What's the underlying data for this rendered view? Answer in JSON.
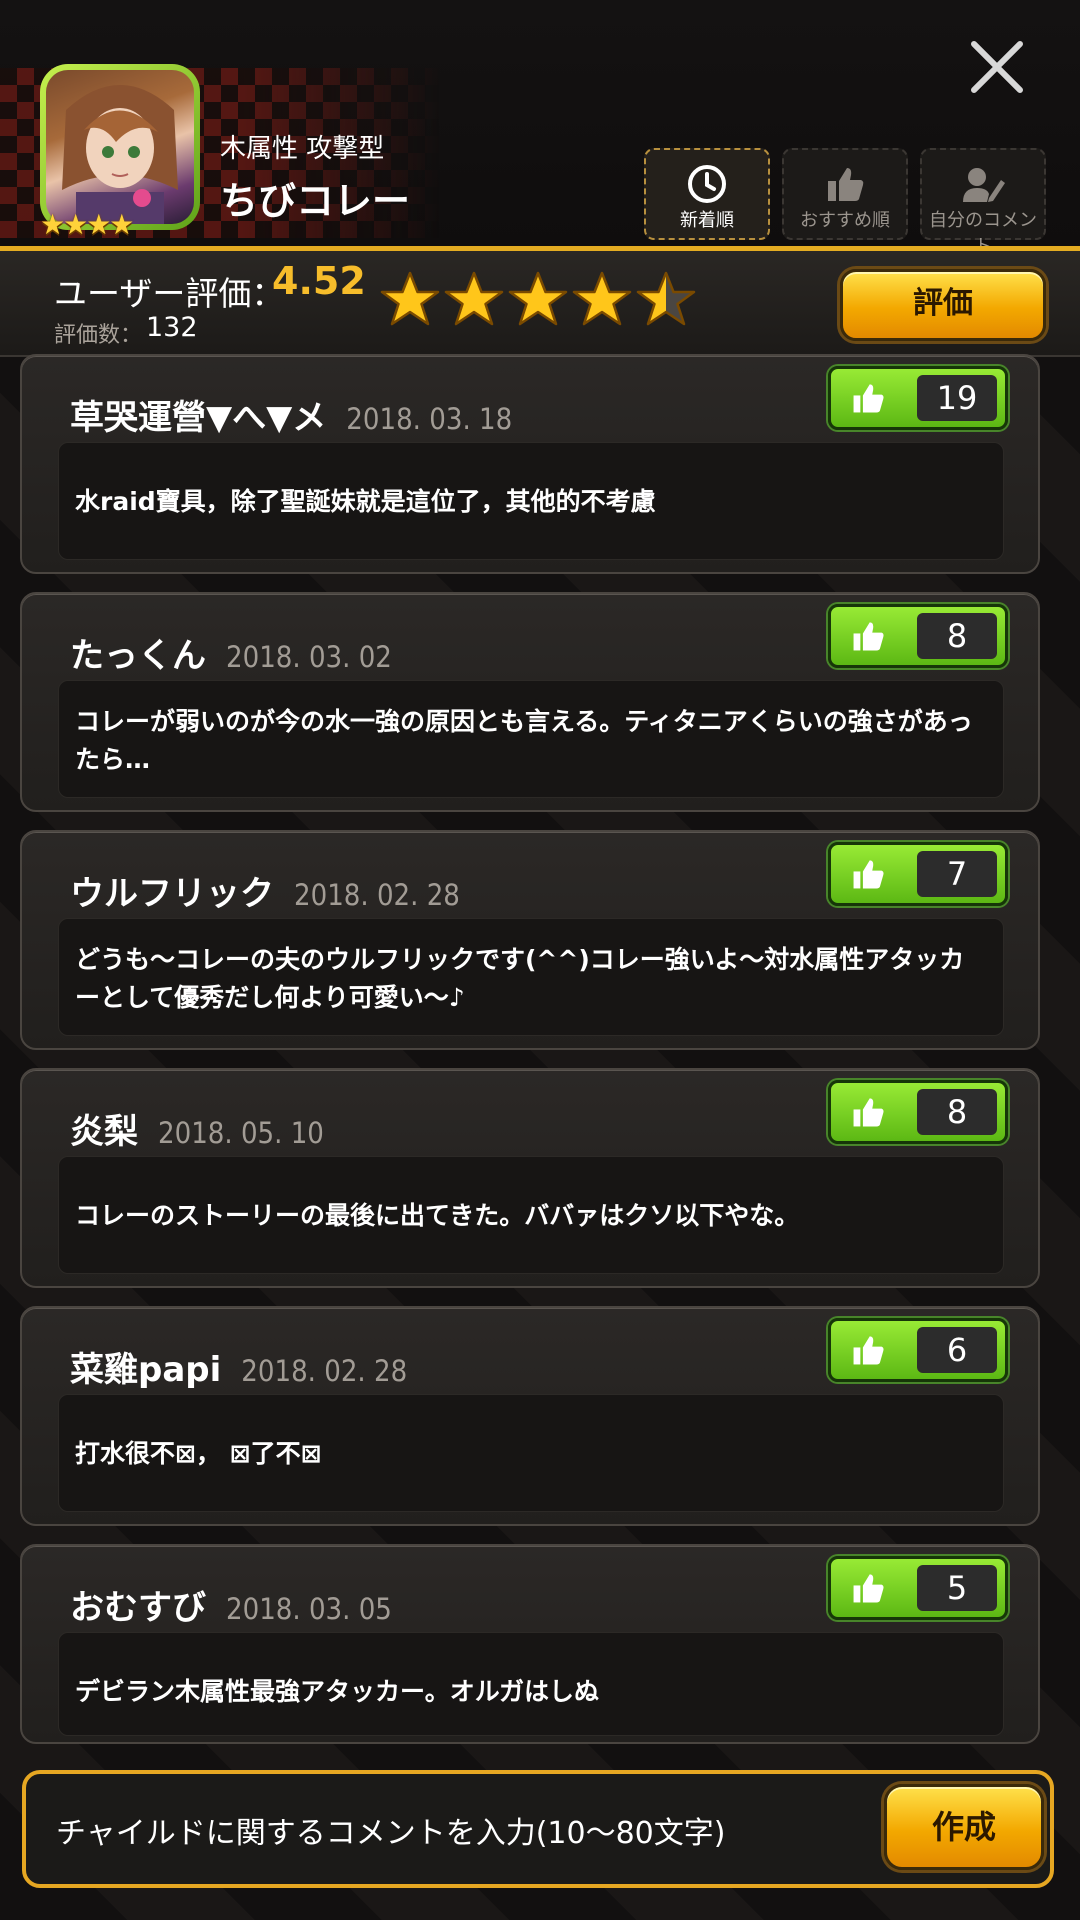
{
  "header": {
    "character_type": "木属性 攻撃型",
    "character_name": "ちびコレー",
    "rarity_stars": "★★★★",
    "sort_tabs": [
      {
        "label": "新着順",
        "icon": "clock-icon",
        "active": true
      },
      {
        "label": "おすすめ順",
        "icon": "thumbs-up-icon",
        "active": false
      },
      {
        "label": "自分のコメント",
        "icon": "user-edit-icon",
        "active": false
      }
    ]
  },
  "rating": {
    "label": "ユーザー評価：",
    "value": "4.52",
    "stars_filled": 4.5,
    "count_label": "評価数：",
    "count": "132",
    "rate_button": "評価"
  },
  "comments": [
    {
      "author": "草哭運營▼へ▼メ",
      "date": "2018. 03. 18",
      "likes": "19",
      "text": "水raid寶具，除了聖誕妹就是這位了，其他的不考慮"
    },
    {
      "author": "たっくん",
      "date": "2018. 03. 02",
      "likes": "8",
      "text": "コレーが弱いのが今の水一強の原因とも言える。ティタニアくらいの強さがあったら…"
    },
    {
      "author": "ウルフリック",
      "date": "2018. 02. 28",
      "likes": "7",
      "text": "どうも～コレーの夫のウルフリックです(^^)コレー強いよ～対水属性アタッカーとして優秀だし何より可愛い～♪"
    },
    {
      "author": "炎梨",
      "date": "2018. 05. 10",
      "likes": "8",
      "text": "コレーのストーリーの最後に出てきた。ババァはクソ以下やな。"
    },
    {
      "author": "菜雞papi",
      "date": "2018. 02. 28",
      "likes": "6",
      "text": "打水很不⊠， ⊠了不⊠"
    },
    {
      "author": "おむすび",
      "date": "2018. 03. 05",
      "likes": "5",
      "text": "デビラン木属性最強アタッカー。オルガはしぬ"
    }
  ],
  "input": {
    "placeholder": "チャイルドに関するコメントを入力(10〜80文字)",
    "submit": "作成"
  },
  "colors": {
    "accent": "#e6a722",
    "like_green": "#6fd11f",
    "rating_gold": "#f7bd2b"
  }
}
